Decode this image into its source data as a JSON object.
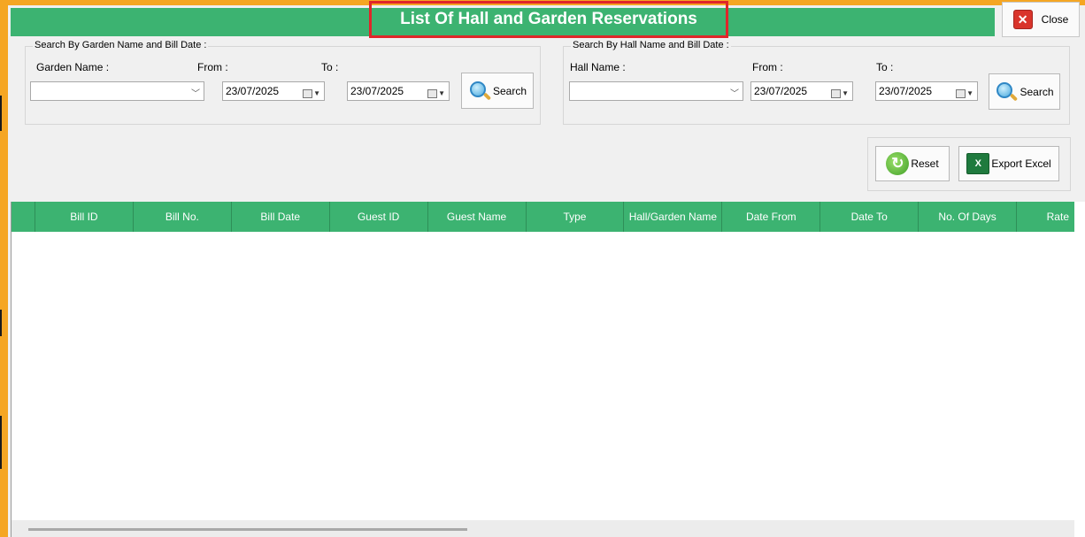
{
  "window": {
    "title": "List Of Hall and Garden Reservations",
    "close_label": "Close"
  },
  "garden_search": {
    "legend": "Search By Garden Name and Bill Date :",
    "name_label": "Garden Name :",
    "from_label": "From :",
    "to_label": "To :",
    "name_value": "",
    "from_value": "23/07/2025",
    "to_value": "23/07/2025",
    "search_label": "Search"
  },
  "hall_search": {
    "legend": "Search By Hall Name and Bill Date :",
    "name_label": "Hall Name :",
    "from_label": "From :",
    "to_label": "To :",
    "name_value": "",
    "from_value": "23/07/2025",
    "to_value": "23/07/2025",
    "search_label": "Search"
  },
  "actions": {
    "reset_label": "Reset",
    "export_label": "Export Excel"
  },
  "grid": {
    "columns": [
      "Bill ID",
      "Bill No.",
      "Bill Date",
      "Guest ID",
      "Guest Name",
      "Type",
      "Hall/Garden Name",
      "Date From",
      "Date To",
      "No. Of Days",
      "Rate"
    ],
    "rows": []
  },
  "colors": {
    "header_green": "#3cb371",
    "highlight_red": "#e0262a",
    "frame_orange": "#f5a623"
  }
}
